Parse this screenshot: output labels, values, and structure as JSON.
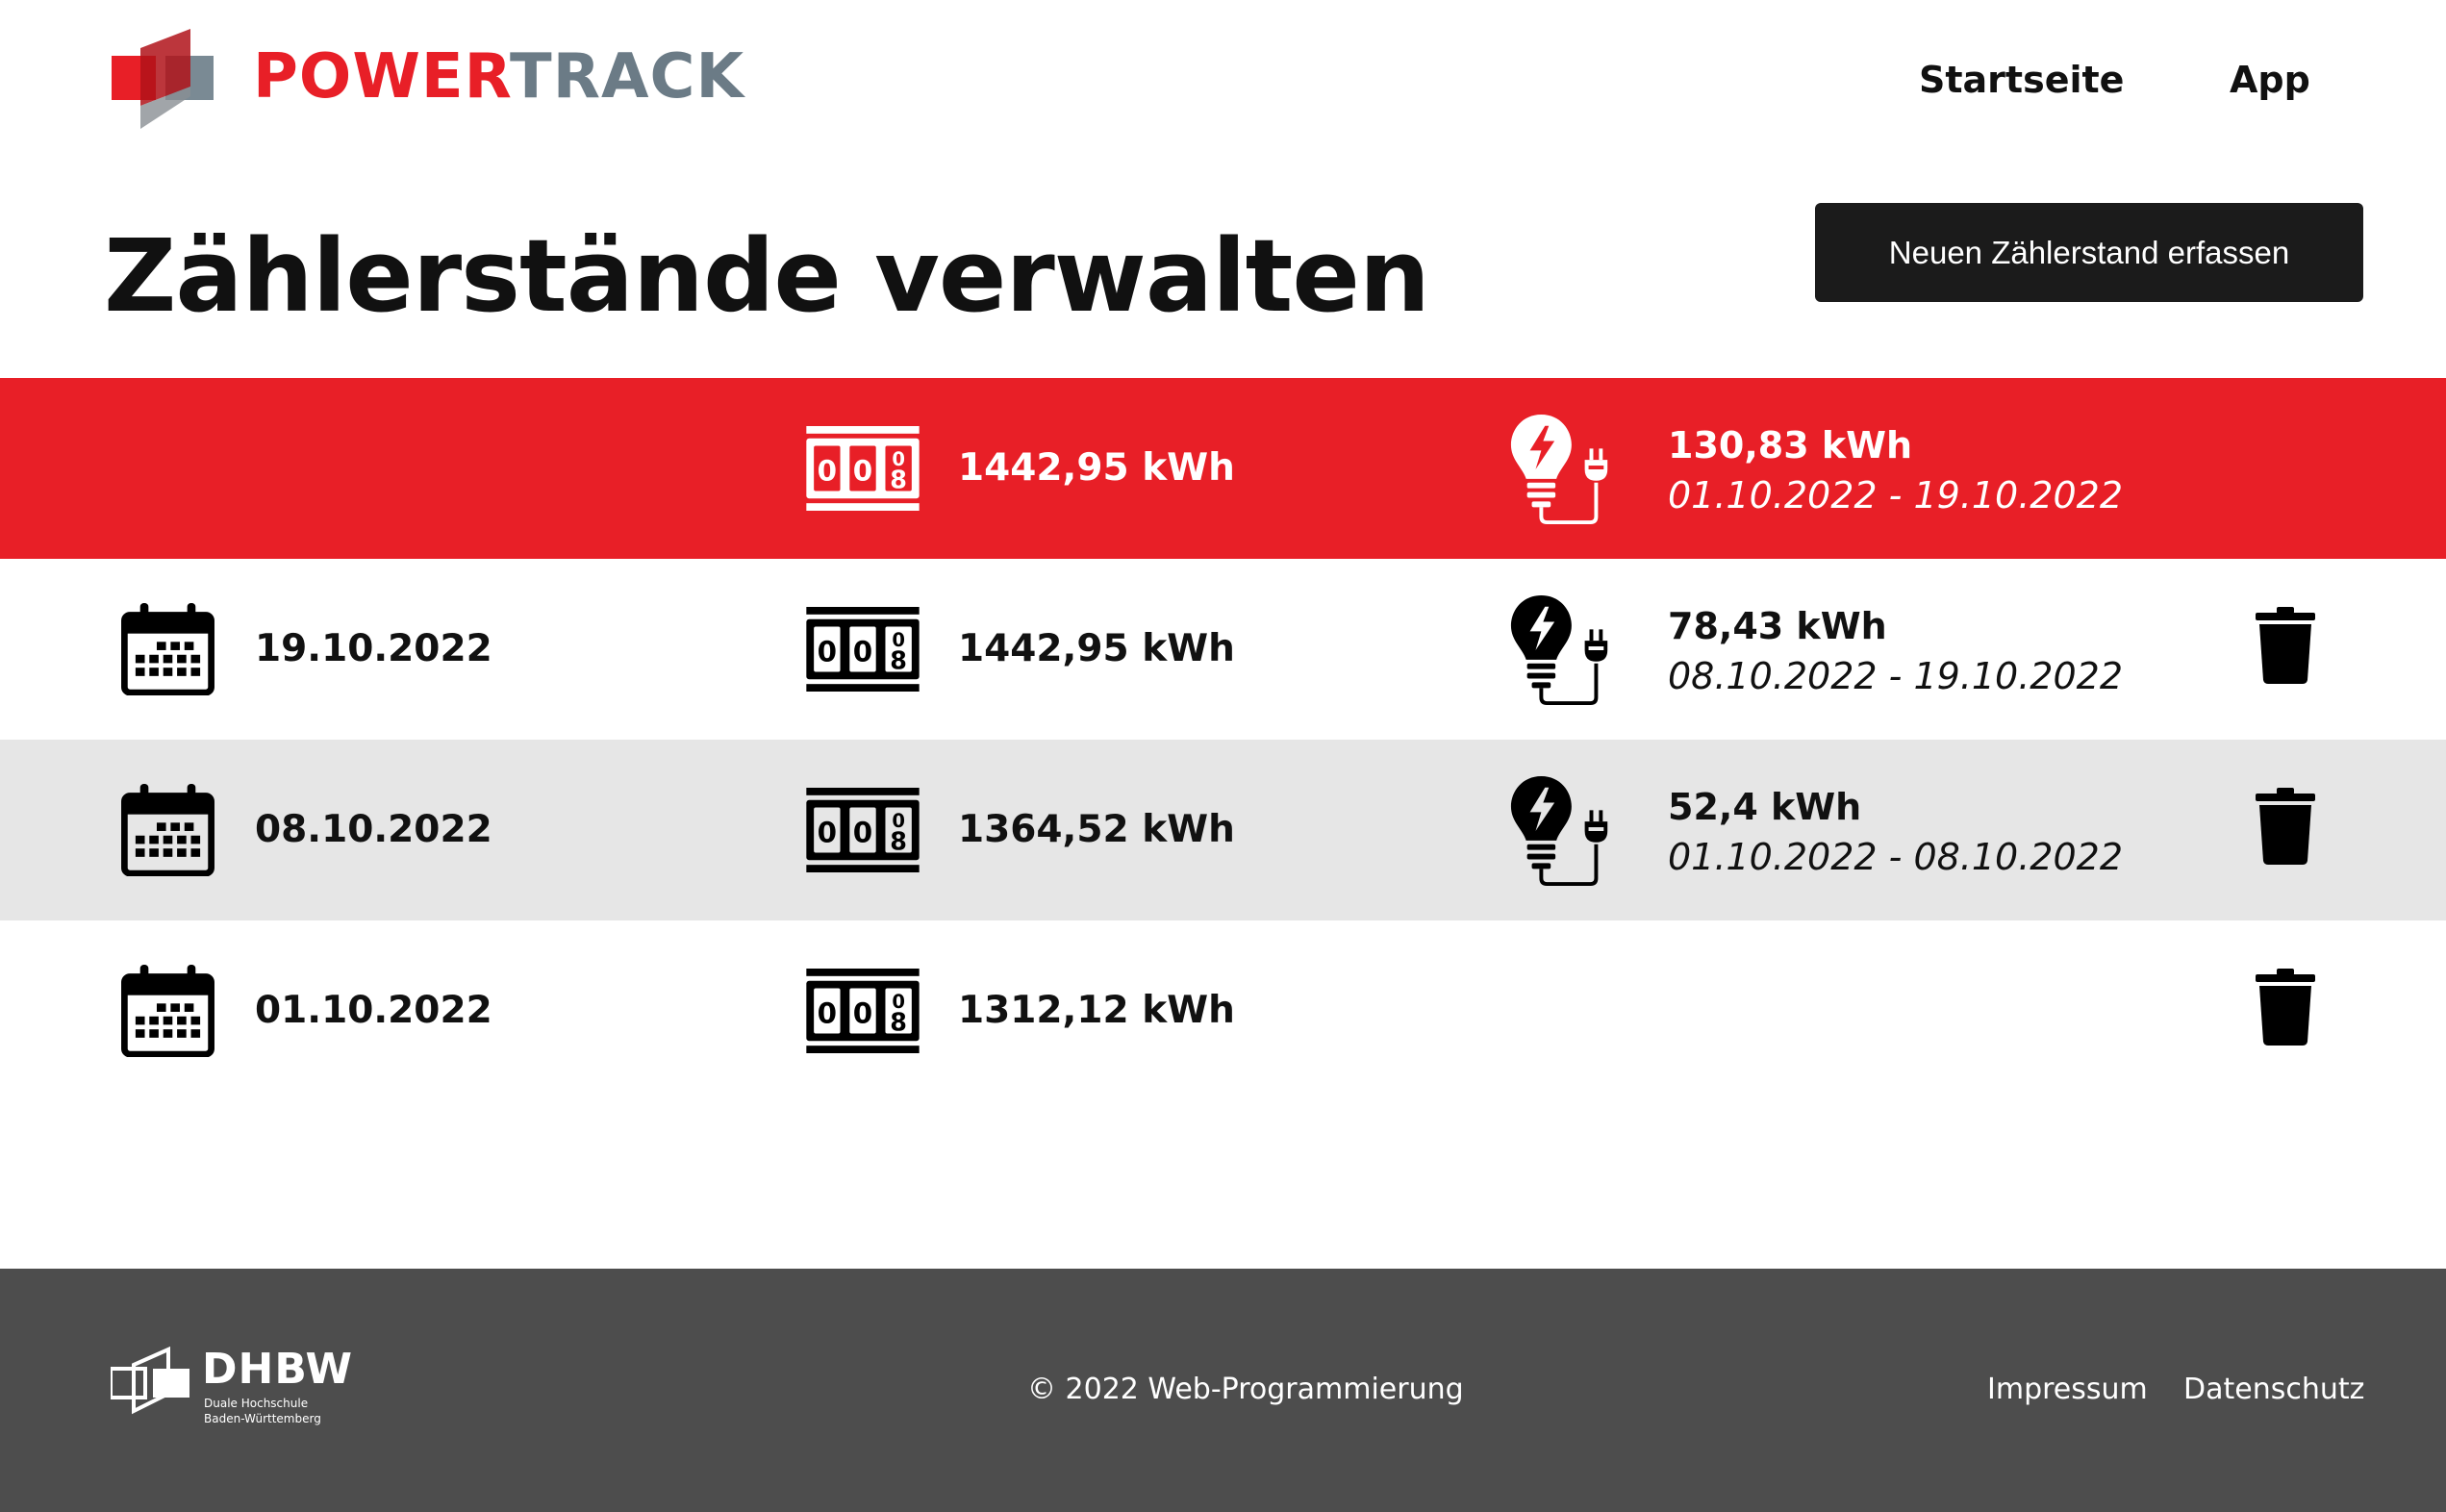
{
  "brand": {
    "name_part1": "POWER",
    "name_part2": "TRACK",
    "colors": {
      "red": "#e81f27",
      "gray": "#6b7b86"
    }
  },
  "nav": {
    "home": "Startseite",
    "app": "App"
  },
  "page": {
    "title": "Zählerstände verwalten",
    "new_button": "Neuen Zählerstand erfassen"
  },
  "summary": {
    "meter_value": "1442,95 kWh",
    "consumption": "130,83 kWh",
    "period": "01.10.2022 - 19.10.2022",
    "background": "#e81f27"
  },
  "readings": [
    {
      "date": "19.10.2022",
      "meter_value": "1442,95 kWh",
      "consumption": "78,43 kWh",
      "period": "08.10.2022 - 19.10.2022"
    },
    {
      "date": "08.10.2022",
      "meter_value": "1364,52 kWh",
      "consumption": "52,4 kWh",
      "period": "01.10.2022 - 08.10.2022"
    },
    {
      "date": "01.10.2022",
      "meter_value": "1312,12 kWh"
    }
  ],
  "icons": {
    "date": "calendar-icon",
    "meter": "meter-counter-icon",
    "consumption": "bulb-plug-icon",
    "delete": "trash-icon"
  },
  "footer": {
    "logo_name": "DHBW",
    "logo_sub": "Duale Hochschule Baden-Württemberg",
    "copyright": "© 2022 Web-Programmierung",
    "impressum": "Impressum",
    "datenschutz": "Datenschutz",
    "background": "#4d4d4d"
  }
}
